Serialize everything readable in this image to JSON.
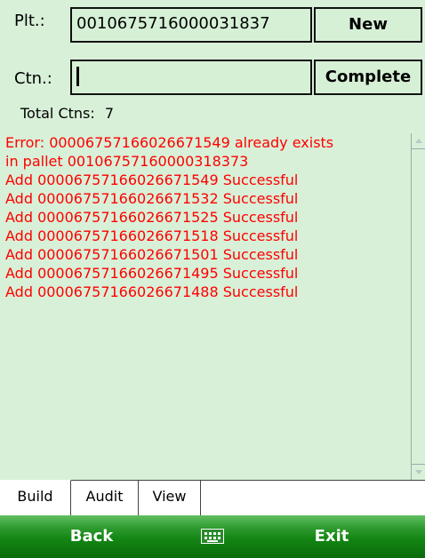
{
  "form": {
    "pallet_label": "Plt.:",
    "pallet_value": "0010675716000031837",
    "new_button": "New",
    "carton_label": "Ctn.:",
    "carton_value": "",
    "complete_button": "Complete",
    "total_cartons_label": "Total Ctns:",
    "total_cartons_value": "7"
  },
  "log": {
    "color": "#ff0000",
    "lines": [
      "Error: 00006757166026671549 already exists",
      "in pallet 00106757160000318373",
      "Add 00006757166026671549 Successful",
      "Add 00006757166026671532 Successful",
      "Add 00006757166026671525 Successful",
      "Add 00006757166026671518 Successful",
      "Add 00006757166026671501 Successful",
      "Add 00006757166026671495 Successful",
      "Add 00006757166026671488 Successful"
    ]
  },
  "tabs": [
    {
      "label": "Build",
      "active": true
    },
    {
      "label": "Audit",
      "active": false
    },
    {
      "label": "View",
      "active": false
    }
  ],
  "softkeys": {
    "left": "Back",
    "center_icon": "keyboard-icon",
    "right": "Exit"
  },
  "colors": {
    "background": "#d8f0d8",
    "softkey_bar": "#138613",
    "log_text": "#ff0000"
  }
}
